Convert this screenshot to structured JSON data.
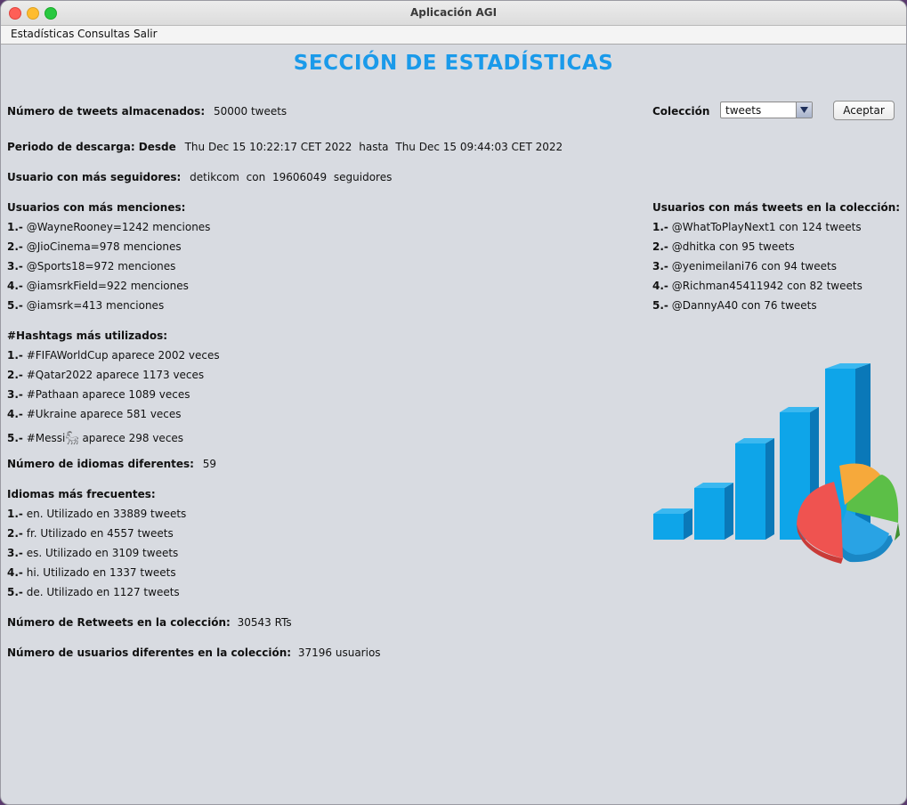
{
  "window": {
    "title": "Aplicación AGI"
  },
  "menu": {
    "items": [
      "Estadísticas",
      "Consultas",
      "Salir"
    ]
  },
  "section_title": "SECCIÓN DE ESTADÍSTICAS",
  "controls": {
    "collection_label": "Colección",
    "collection_value": "tweets",
    "accept_label": "Aceptar"
  },
  "stats": {
    "tweets_label": "Número de tweets almacenados:",
    "tweets_value": "50000 tweets",
    "period_label": "Periodo de descarga: Desde",
    "period_from": "Thu Dec 15 10:22:17 CET 2022",
    "period_until_word": "hasta",
    "period_to": "Thu Dec 15 09:44:03 CET 2022",
    "followers_label": "Usuario con más seguidores:",
    "followers_user": "detikcom",
    "followers_con": "con",
    "followers_count": "19606049",
    "followers_suffix": "seguidores",
    "mentions_title": "Usuarios con más menciones:",
    "mentions": [
      {
        "n": "1.-",
        "text": "@WayneRooney=1242 menciones"
      },
      {
        "n": "2.-",
        "text": "@JioCinema=978 menciones"
      },
      {
        "n": "3.-",
        "text": "@Sports18=972 menciones"
      },
      {
        "n": "4.-",
        "text": "@iamsrkField=922 menciones"
      },
      {
        "n": "5.-",
        "text": "@iamsrk=413 menciones"
      }
    ],
    "hashtags_title": "#Hashtags más utilizados:",
    "hashtags": [
      {
        "n": "1.-",
        "text": "#FIFAWorldCup aparece 2002 veces"
      },
      {
        "n": "2.-",
        "text": "#Qatar2022 aparece 1173 veces"
      },
      {
        "n": "3.-",
        "text": "#Pathaan aparece 1089 veces"
      },
      {
        "n": "4.-",
        "text": "#Ukraine aparece 581 veces"
      },
      {
        "n": "5.-",
        "text": "#Messi𓃵 aparece 298 veces"
      }
    ],
    "languages_count_label": "Número de idiomas diferentes:",
    "languages_count_value": "59",
    "languages_title": "Idiomas más frecuentes:",
    "languages": [
      {
        "n": "1.-",
        "text": "en. Utilizado en 33889 tweets"
      },
      {
        "n": "2.-",
        "text": "fr. Utilizado en 4557 tweets"
      },
      {
        "n": "3.-",
        "text": "es. Utilizado en 3109 tweets"
      },
      {
        "n": "4.-",
        "text": "hi. Utilizado en 1337 tweets"
      },
      {
        "n": "5.-",
        "text": "de. Utilizado en 1127 tweets"
      }
    ],
    "retweets_label": "Número de Retweets en la colección:",
    "retweets_value": "30543 RTs",
    "users_label": "Número de usuarios diferentes en la colección:",
    "users_value": "37196 usuarios",
    "top_tweeters_title": "Usuarios con más tweets en la colección:",
    "top_tweeters": [
      {
        "n": "1.-",
        "text": "@WhatToPlayNext1 con 124 tweets"
      },
      {
        "n": "2.-",
        "text": "@dhitka con 95 tweets"
      },
      {
        "n": "3.-",
        "text": "@yenimeilani76 con 94 tweets"
      },
      {
        "n": "4.-",
        "text": "@Richman45411942 con 82 tweets"
      },
      {
        "n": "5.-",
        "text": "@DannyA40 con 76 tweets"
      }
    ]
  },
  "colors": {
    "title": "#1a9aea",
    "bar": "#0ea5e9",
    "pie_red": "#ef5350",
    "pie_green": "#5cbf47",
    "pie_orange": "#f6a93b",
    "pie_blue": "#29a3e4"
  }
}
